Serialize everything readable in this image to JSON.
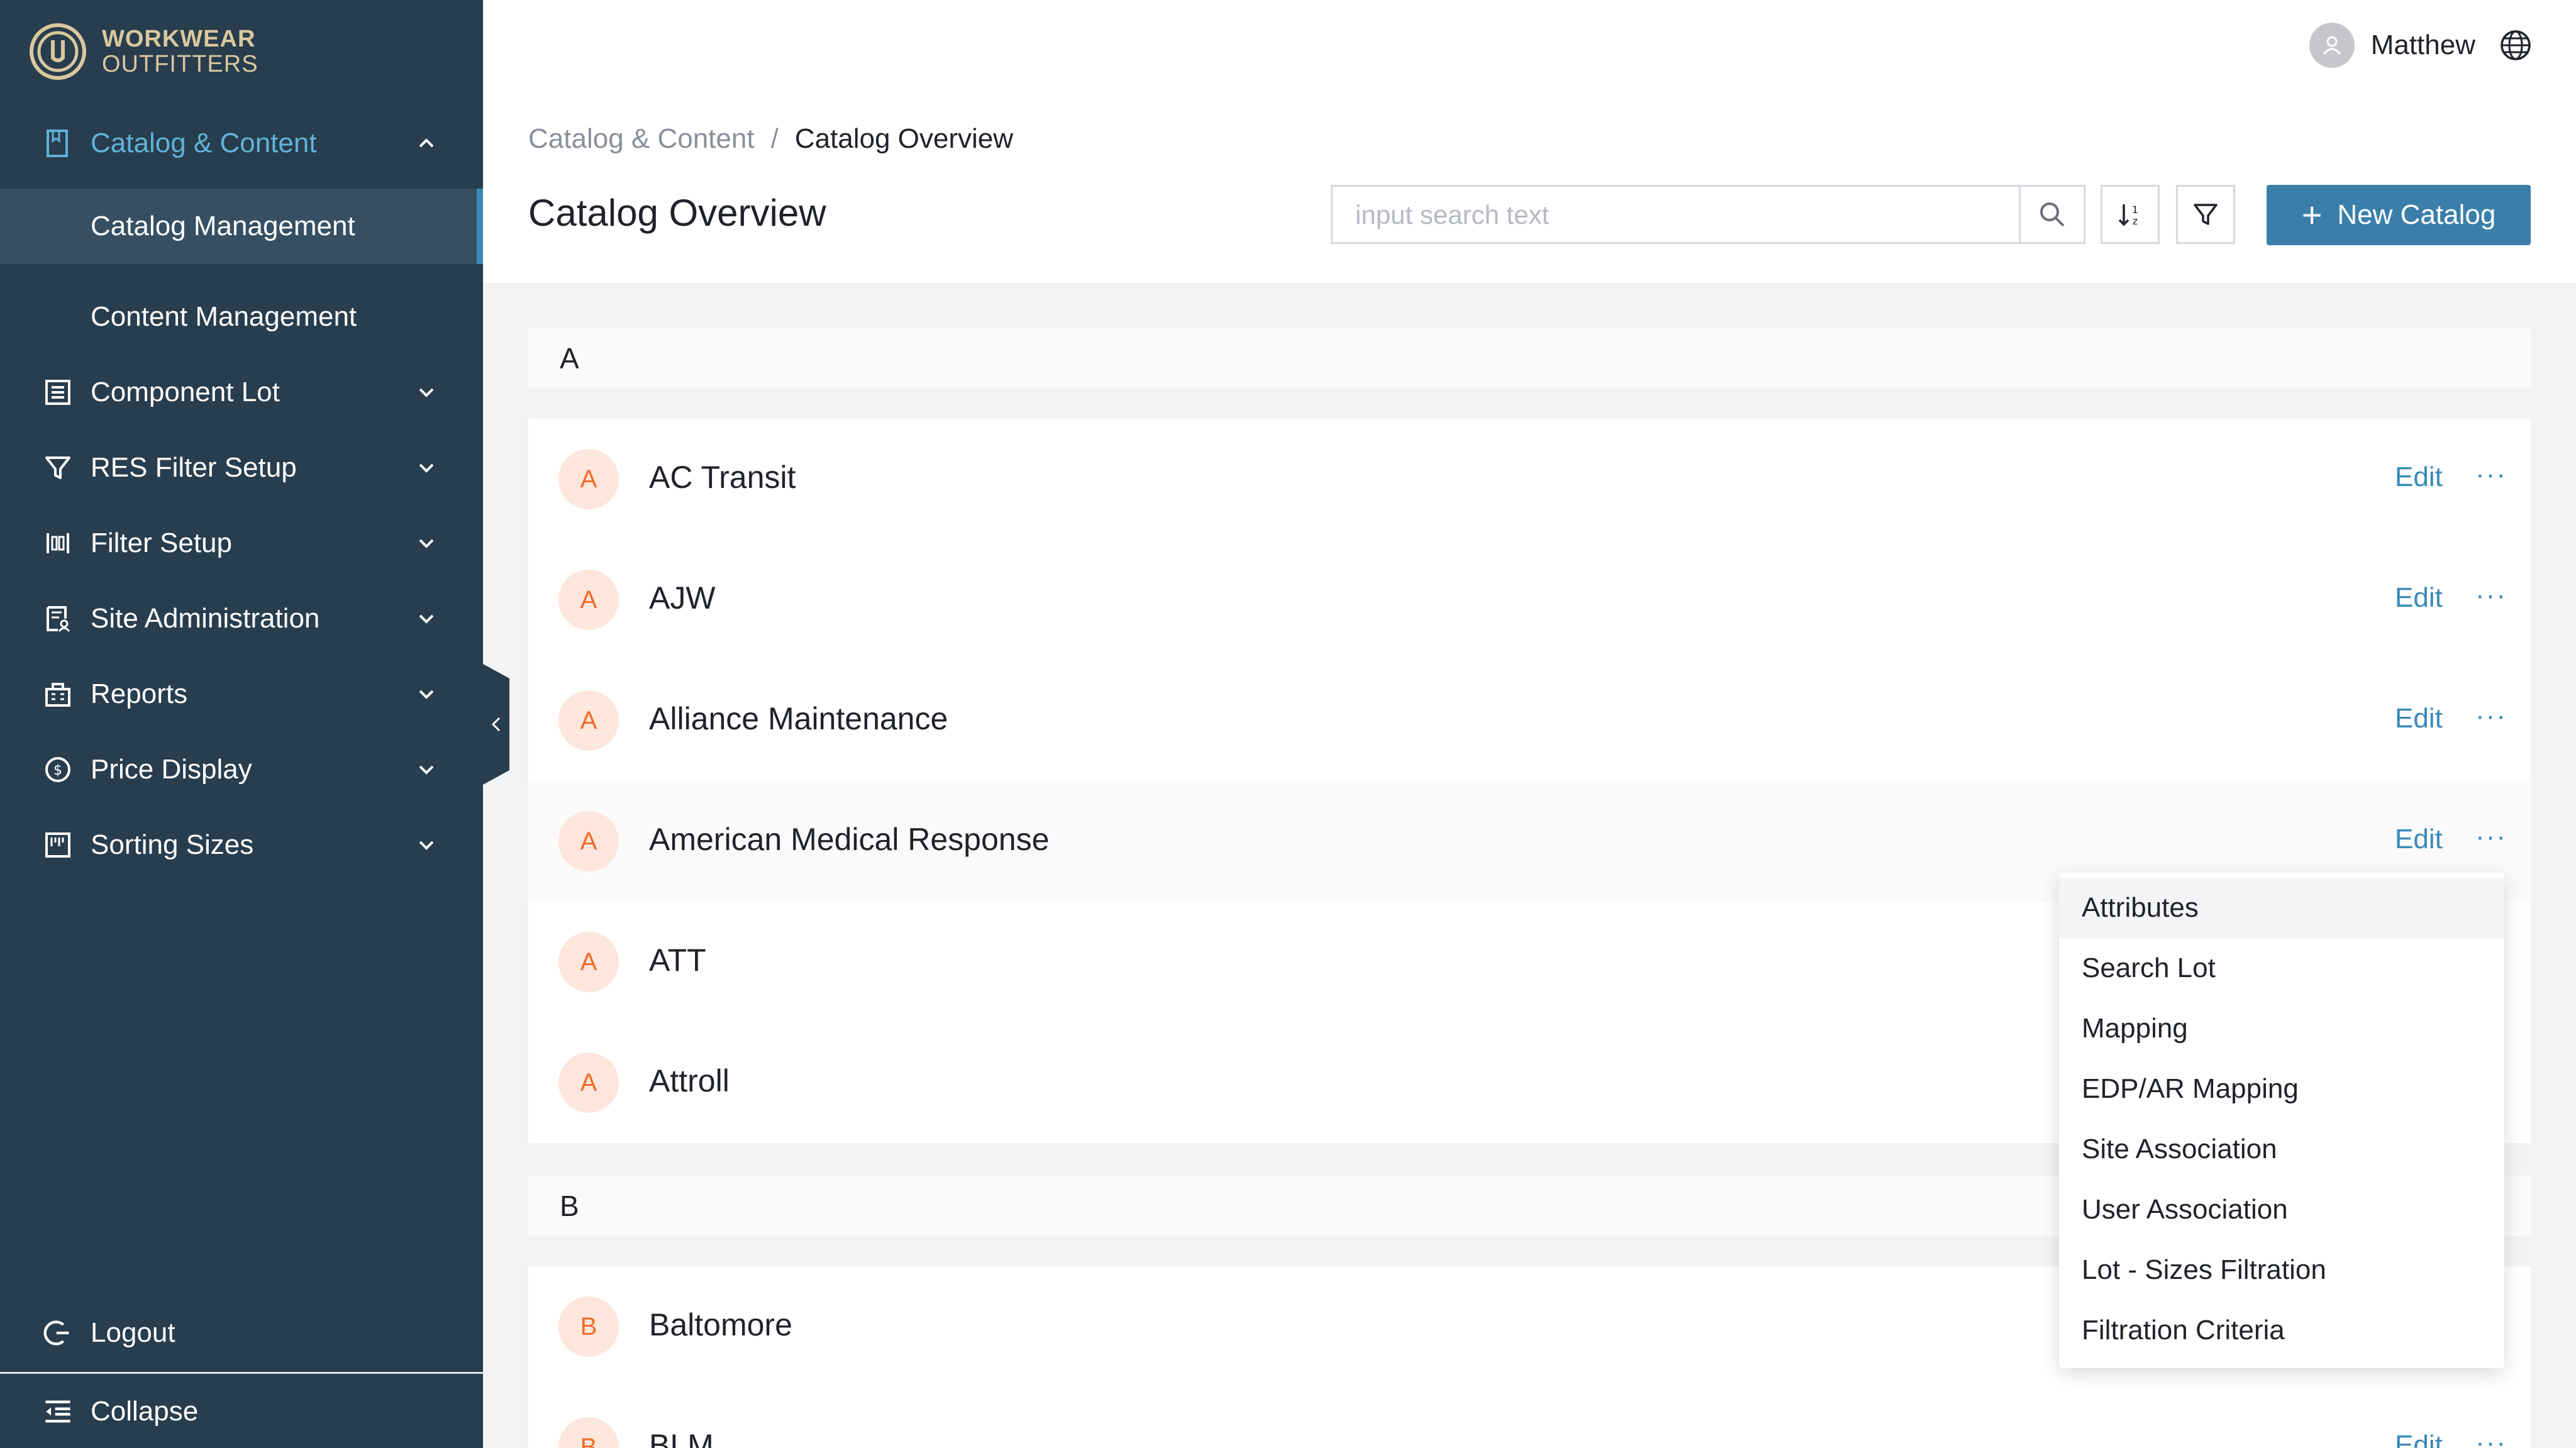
{
  "brand": {
    "line1": "WORKWEAR",
    "line2": "OUTFITTERS"
  },
  "sidebar": {
    "items": [
      {
        "label": "Catalog & Content",
        "icon": "book-icon"
      },
      {
        "label": "Catalog Management"
      },
      {
        "label": "Content Management"
      },
      {
        "label": "Component Lot",
        "icon": "list-box-icon"
      },
      {
        "label": "RES Filter Setup",
        "icon": "filter-icon"
      },
      {
        "label": "Filter Setup",
        "icon": "sliders-icon"
      },
      {
        "label": "Site Administration",
        "icon": "document-user-icon"
      },
      {
        "label": "Reports",
        "icon": "building-icon"
      },
      {
        "label": "Price Display",
        "icon": "dollar-circle-icon"
      },
      {
        "label": "Sorting Sizes",
        "icon": "ruler-box-icon"
      }
    ],
    "logout": "Logout",
    "collapse": "Collapse"
  },
  "header": {
    "username": "Matthew",
    "breadcrumb": {
      "parent": "Catalog & Content",
      "separator": "/",
      "current": "Catalog Overview"
    },
    "title": "Catalog Overview",
    "search_placeholder": "input search text",
    "new_button": "New Catalog"
  },
  "groups": [
    {
      "letter": "A",
      "items": [
        {
          "initial": "A",
          "name": "AC Transit",
          "edit": "Edit",
          "more": "···"
        },
        {
          "initial": "A",
          "name": "AJW",
          "edit": "Edit",
          "more": "···"
        },
        {
          "initial": "A",
          "name": "Alliance Maintenance",
          "edit": "Edit",
          "more": "···"
        },
        {
          "initial": "A",
          "name": "American Medical Response",
          "edit": "Edit",
          "more": "···"
        },
        {
          "initial": "A",
          "name": "ATT"
        },
        {
          "initial": "A",
          "name": "Attroll"
        }
      ]
    },
    {
      "letter": "B",
      "items": [
        {
          "initial": "B",
          "name": "Baltomore"
        },
        {
          "initial": "B",
          "name": "BLM",
          "edit": "Edit",
          "more": "···"
        }
      ]
    }
  ],
  "dropdown": {
    "items": [
      "Attributes",
      "Search Lot",
      "Mapping",
      "EDP/AR Mapping",
      "Site Association",
      "User Association",
      "Lot - Sizes Filtration",
      "Filtration Criteria"
    ]
  },
  "colors": {
    "sidebar_bg": "#283d4d",
    "accent": "#3a7fa9",
    "active_text": "#5fb3d8",
    "badge_bg": "#fde7dc",
    "badge_text": "#f06b2a",
    "link": "#3a8ab8"
  }
}
